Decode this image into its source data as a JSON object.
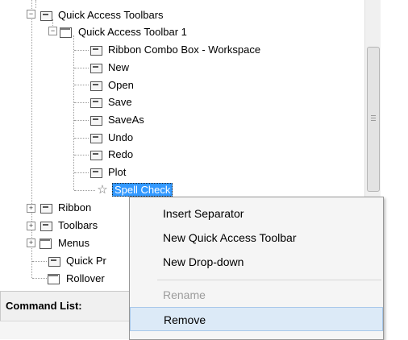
{
  "tree": {
    "items": [
      {
        "label": "Quick Access Toolbars",
        "icon": "quick-access-toolbars-icon"
      },
      {
        "label": "Quick Access Toolbar 1",
        "icon": "quick-access-toolbar-icon"
      },
      {
        "label": "Ribbon Combo Box - Workspace",
        "icon": "toolbar-button-icon"
      },
      {
        "label": "New",
        "icon": "toolbar-button-icon"
      },
      {
        "label": "Open",
        "icon": "toolbar-button-icon"
      },
      {
        "label": "Save",
        "icon": "toolbar-button-icon"
      },
      {
        "label": "SaveAs",
        "icon": "toolbar-button-icon"
      },
      {
        "label": "Undo",
        "icon": "toolbar-button-icon"
      },
      {
        "label": "Redo",
        "icon": "toolbar-button-icon"
      },
      {
        "label": "Plot",
        "icon": "toolbar-button-icon"
      },
      {
        "label": "Spell Check",
        "icon": "star-icon",
        "selected": true
      },
      {
        "label": "Ribbon",
        "icon": "ribbon-icon"
      },
      {
        "label": "Toolbars",
        "icon": "toolbars-icon"
      },
      {
        "label": "Menus",
        "icon": "menus-icon"
      },
      {
        "label": "Quick Pr",
        "icon": "quick-properties-icon"
      },
      {
        "label": "Rollover",
        "icon": "rollover-icon"
      }
    ]
  },
  "command_list": {
    "label": "Command List:"
  },
  "context_menu": {
    "items": [
      {
        "label": "Insert Separator",
        "enabled": true
      },
      {
        "label": "New Quick Access Toolbar",
        "enabled": true
      },
      {
        "label": "New Drop-down",
        "enabled": true
      },
      {
        "label": "Rename",
        "enabled": false
      },
      {
        "label": "Remove",
        "enabled": true,
        "hovered": true
      }
    ]
  },
  "colors": {
    "selection": "#3399ff",
    "menu_background": "#f5f5f5",
    "menu_hover": "#dceaf7",
    "disabled_text": "#9c9c9c"
  }
}
